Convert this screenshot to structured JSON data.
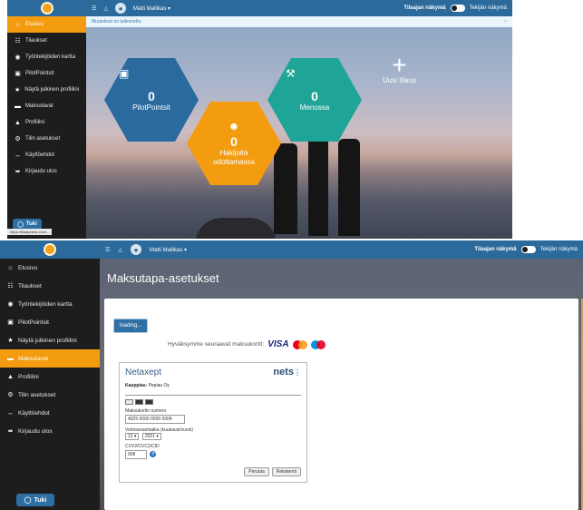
{
  "screen1": {
    "topbar": {
      "user": "Matti Mallikas",
      "toggle_left": "Tilaajan näkymä",
      "toggle_right": "Tekijän näkymä"
    },
    "sidebar": {
      "items": [
        {
          "icon": "home-icon",
          "glyph": "⌂",
          "label": "Etusivu",
          "active": true
        },
        {
          "icon": "orders-icon",
          "glyph": "☷",
          "label": "Tilaukset",
          "active": false
        },
        {
          "icon": "map-marker-icon",
          "glyph": "◉",
          "label": "Työntekijöiden kartta",
          "active": false
        },
        {
          "icon": "pilotpoints-icon",
          "glyph": "▣",
          "label": "PilotPointsit",
          "active": false
        },
        {
          "icon": "star-icon",
          "glyph": "★",
          "label": "Näytä julkinen profiilini",
          "active": false
        },
        {
          "icon": "payment-icon",
          "glyph": "▬",
          "label": "Maksutavat",
          "active": false
        },
        {
          "icon": "user-icon",
          "glyph": "▲",
          "label": "Profiilini",
          "active": false
        },
        {
          "icon": "gear-icon",
          "glyph": "⚙",
          "label": "Tilin asetukset",
          "active": false
        },
        {
          "icon": "handshake-icon",
          "glyph": "↔",
          "label": "Käyttöehdot",
          "active": false
        },
        {
          "icon": "logout-icon",
          "glyph": "➠",
          "label": "Kirjaudu ulos",
          "active": false
        }
      ],
      "help_label": "Tuki",
      "status_url": "https://tilaajanetu.com/..."
    },
    "notice": "Muutokset on tallennettu",
    "tiles": {
      "pilotpoints": {
        "value": "0",
        "label": "PilotPointsit"
      },
      "applicants": {
        "value": "0",
        "label_line1": "Hakijoita",
        "label_line2": "odottamassa"
      },
      "in_progress": {
        "value": "0",
        "label": "Menossa"
      },
      "new_order": {
        "label": "Uusi tilaus"
      }
    }
  },
  "screen2": {
    "topbar": {
      "user": "Matti Mallikas",
      "toggle_left": "Tilaajan näkymä",
      "toggle_right": "Tekijän näkymä"
    },
    "sidebar": {
      "items": [
        {
          "icon": "home-icon",
          "glyph": "⌂",
          "label": "Etusivu",
          "active": false
        },
        {
          "icon": "orders-icon",
          "glyph": "☷",
          "label": "Tilaukset",
          "active": false
        },
        {
          "icon": "map-marker-icon",
          "glyph": "◉",
          "label": "Työntekijöiden kartta",
          "active": false
        },
        {
          "icon": "pilotpoints-icon",
          "glyph": "▣",
          "label": "PilotPointsit",
          "active": false
        },
        {
          "icon": "star-icon",
          "glyph": "★",
          "label": "Näytä julkinen profiilini",
          "active": false
        },
        {
          "icon": "payment-icon",
          "glyph": "▬",
          "label": "Maksutavat",
          "active": true
        },
        {
          "icon": "user-icon",
          "glyph": "▲",
          "label": "Profiilini",
          "active": false
        },
        {
          "icon": "gear-icon",
          "glyph": "⚙",
          "label": "Tilin asetukset",
          "active": false
        },
        {
          "icon": "handshake-icon",
          "glyph": "↔",
          "label": "Käyttöehdot",
          "active": false
        },
        {
          "icon": "logout-icon",
          "glyph": "➠",
          "label": "Kirjaudu ulos",
          "active": false
        }
      ],
      "help_label": "Tuki"
    },
    "page_title": "Maksutapa-asetukset",
    "loading_button": "loading...",
    "accept_text": "Hyväksymme seuraavat maksukortit:",
    "visa_label": "VISA",
    "netaxept": {
      "title": "Netaxept",
      "logo": "nets",
      "seller_label": "Kauppias:",
      "seller_value": "Pepiau Oy",
      "card_number_label": "Maksukortin numero",
      "card_number_value": "4925 0000 0000 0004",
      "expiry_label": "Voimassaoloaika (kuukausi/vuosi)",
      "expiry_month": "12",
      "expiry_year": "2021",
      "cvv_label": "CVV2/CVC2/CID",
      "cvv_value": "908",
      "cancel_label": "Peruuta",
      "register_label": "Rekisteröi"
    }
  }
}
